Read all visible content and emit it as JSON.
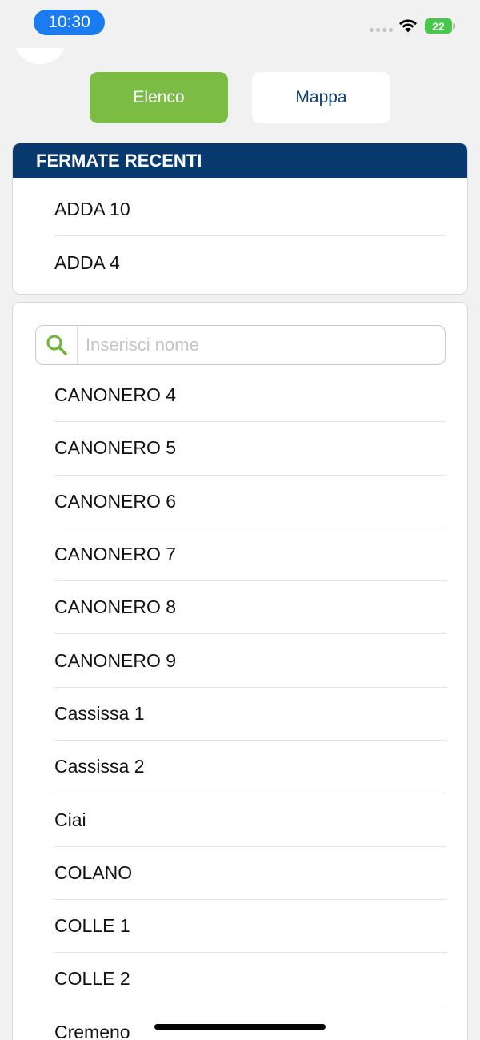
{
  "status_bar": {
    "time": "10:30",
    "battery": "22",
    "battery_color": "#48c84a",
    "icons": [
      "signal-dots-icon",
      "wifi-icon",
      "battery-icon"
    ]
  },
  "toggle": {
    "list_label": "Elenco",
    "map_label": "Mappa",
    "active": "Elenco",
    "active_color": "#7bbd43"
  },
  "recent": {
    "title": "FERMATE RECENTI",
    "header_color": "#083a70",
    "items": [
      "ADDA 10",
      "ADDA 4"
    ]
  },
  "search": {
    "placeholder": "Inserisci nome",
    "value": "",
    "icon": "search-icon",
    "icon_color": "#6db63c"
  },
  "stops": {
    "items": [
      "CANONERO 4",
      "CANONERO 5",
      "CANONERO 6",
      "CANONERO 7",
      "CANONERO 8",
      "CANONERO 9",
      "Cassissa 1",
      "Cassissa 2",
      "Ciai",
      "COLANO",
      "COLLE 1",
      "COLLE 2",
      "Cremeno"
    ]
  }
}
